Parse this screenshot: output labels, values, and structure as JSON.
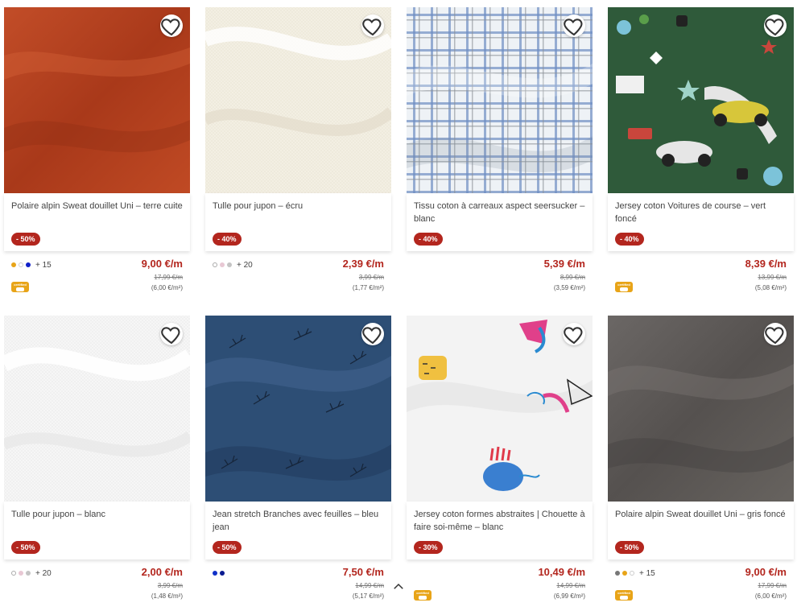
{
  "products": [
    {
      "title": "Polaire alpin Sweat douillet Uni – terre cuite",
      "discount": "- 50%",
      "price": "9,00 €/m",
      "old_price": "17,99 €/m",
      "unit_price": "(6,00 €/m²)",
      "more_colors": "+ 15",
      "colors": [
        "#e8a418",
        "#ffffff",
        "#1020c8"
      ],
      "certified": true,
      "certified_label": "certified",
      "fabric_color": "#b5421d"
    },
    {
      "title": "Tulle pour jupon – écru",
      "discount": "- 40%",
      "price": "2,39 €/m",
      "old_price": "3,99 €/m",
      "unit_price": "(1,77 €/m²)",
      "more_colors": "+ 20",
      "colors": [
        "#ffffff",
        "#e8c8d4",
        "#c4c4c4"
      ],
      "certified": false,
      "fabric_color": "#f1ede0"
    },
    {
      "title": "Tissu coton à carreaux aspect seersucker – blanc",
      "discount": "- 40%",
      "price": "5,39 €/m",
      "old_price": "8,99 €/m",
      "unit_price": "(3,59 €/m²)",
      "more_colors": "",
      "colors": [],
      "certified": false,
      "fabric_color": "#e6ecf2"
    },
    {
      "title": "Jersey coton Voitures de course – vert foncé",
      "discount": "- 40%",
      "price": "8,39 €/m",
      "old_price": "13,99 €/m",
      "unit_price": "(5,08 €/m²)",
      "more_colors": "",
      "colors": [],
      "certified": true,
      "certified_label": "certified",
      "fabric_color": "#2f5a3a"
    },
    {
      "title": "Tulle pour jupon – blanc",
      "discount": "- 50%",
      "price": "2,00 €/m",
      "old_price": "3,99 €/m",
      "unit_price": "(1,48 €/m²)",
      "more_colors": "+ 20",
      "colors": [
        "#ffffff",
        "#e8c8d4",
        "#c4c4c4"
      ],
      "certified": false,
      "fabric_color": "#f4f4f4"
    },
    {
      "title": "Jean stretch Branches avec feuilles – bleu jean",
      "discount": "- 50%",
      "price": "7,50 €/m",
      "old_price": "14,99 €/m",
      "unit_price": "(5,17 €/m²)",
      "more_colors": "",
      "colors": [
        "#1030c8",
        "#0a1a90"
      ],
      "certified": false,
      "fabric_color": "#2d4e75"
    },
    {
      "title": "Jersey coton formes abstraites | Chouette à faire soi-même – blanc",
      "discount": "- 30%",
      "price": "10,49 €/m",
      "old_price": "14,99 €/m",
      "unit_price": "(6,99 €/m²)",
      "more_colors": "",
      "colors": [],
      "certified": true,
      "certified_label": "certified",
      "fabric_color": "#f3f3f3"
    },
    {
      "title": "Polaire alpin Sweat douillet Uni – gris foncé",
      "discount": "- 50%",
      "price": "9,00 €/m",
      "old_price": "17,99 €/m",
      "unit_price": "(6,00 €/m²)",
      "more_colors": "+ 15",
      "colors": [
        "#777777",
        "#e8a418",
        "#ffffff"
      ],
      "certified": true,
      "certified_label": "certified",
      "fabric_color": "#5f5b59"
    }
  ],
  "icons": {
    "favorite": "heart-outline-icon",
    "scroll": "chevron-up-icon"
  },
  "accent_color": "#b3261e"
}
